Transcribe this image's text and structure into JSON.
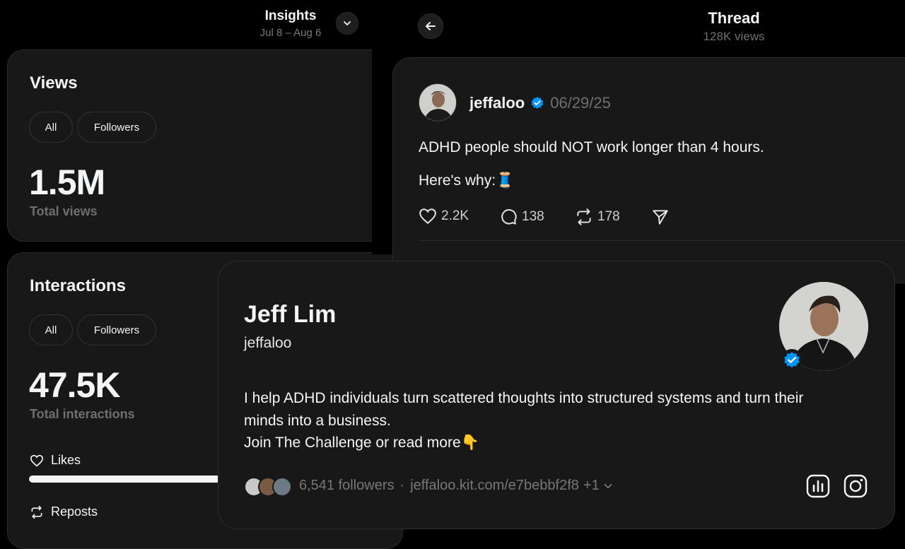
{
  "insights": {
    "title": "Insights",
    "date_range": "Jul 8 – Aug 6",
    "views": {
      "title": "Views",
      "filters": [
        "All",
        "Followers"
      ],
      "total": "1.5M",
      "total_label": "Total views"
    },
    "interactions": {
      "title": "Interactions",
      "filters": [
        "All",
        "Followers"
      ],
      "total": "47.5K",
      "total_label": "Total interactions",
      "breakdown": [
        {
          "label": "Likes",
          "icon": "heart-icon",
          "fraction": 1.0
        },
        {
          "label": "Reposts",
          "icon": "repost-icon"
        }
      ]
    }
  },
  "thread": {
    "title": "Thread",
    "views": "128K views",
    "post": {
      "username": "jeffaloo",
      "date": "06/29/25",
      "verified": true,
      "line1": "ADHD people should NOT work longer than 4 hours.",
      "line2": "Here's why:🧵",
      "likes": "2.2K",
      "replies": "138",
      "reposts": "178"
    }
  },
  "profile": {
    "name": "Jeff Lim",
    "handle": "jeffaloo",
    "bio_line1": "I help ADHD individuals turn scattered thoughts into structured systems and turn their",
    "bio_line2": "minds into a business.",
    "bio_line3": "Join The Challenge or read more👇",
    "followers": "6,541 followers",
    "separator": "·",
    "link": "jeffaloo.kit.com/e7bebbf2f8",
    "link_more": "+1"
  },
  "colors": {
    "background": "#000000",
    "card": "#181818",
    "verified_blue": "#0095f6",
    "muted_text": "#6f6f6f"
  }
}
